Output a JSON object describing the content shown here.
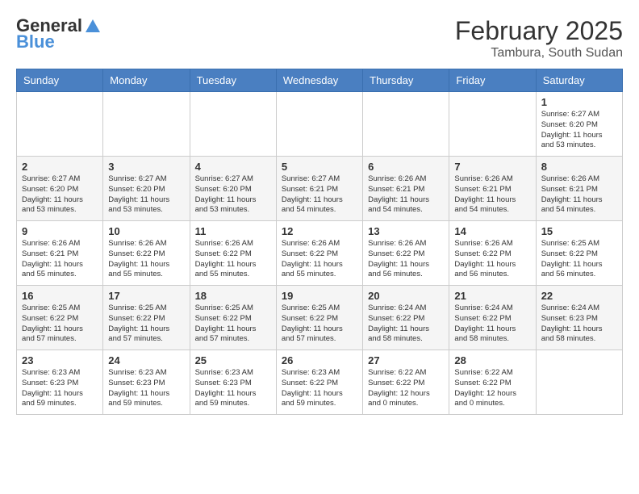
{
  "logo": {
    "line1": "General",
    "line2": "Blue"
  },
  "title": "February 2025",
  "subtitle": "Tambura, South Sudan",
  "weekdays": [
    "Sunday",
    "Monday",
    "Tuesday",
    "Wednesday",
    "Thursday",
    "Friday",
    "Saturday"
  ],
  "weeks": [
    [
      {
        "day": "",
        "info": ""
      },
      {
        "day": "",
        "info": ""
      },
      {
        "day": "",
        "info": ""
      },
      {
        "day": "",
        "info": ""
      },
      {
        "day": "",
        "info": ""
      },
      {
        "day": "",
        "info": ""
      },
      {
        "day": "1",
        "info": "Sunrise: 6:27 AM\nSunset: 6:20 PM\nDaylight: 11 hours\nand 53 minutes."
      }
    ],
    [
      {
        "day": "2",
        "info": "Sunrise: 6:27 AM\nSunset: 6:20 PM\nDaylight: 11 hours\nand 53 minutes."
      },
      {
        "day": "3",
        "info": "Sunrise: 6:27 AM\nSunset: 6:20 PM\nDaylight: 11 hours\nand 53 minutes."
      },
      {
        "day": "4",
        "info": "Sunrise: 6:27 AM\nSunset: 6:20 PM\nDaylight: 11 hours\nand 53 minutes."
      },
      {
        "day": "5",
        "info": "Sunrise: 6:27 AM\nSunset: 6:21 PM\nDaylight: 11 hours\nand 54 minutes."
      },
      {
        "day": "6",
        "info": "Sunrise: 6:26 AM\nSunset: 6:21 PM\nDaylight: 11 hours\nand 54 minutes."
      },
      {
        "day": "7",
        "info": "Sunrise: 6:26 AM\nSunset: 6:21 PM\nDaylight: 11 hours\nand 54 minutes."
      },
      {
        "day": "8",
        "info": "Sunrise: 6:26 AM\nSunset: 6:21 PM\nDaylight: 11 hours\nand 54 minutes."
      }
    ],
    [
      {
        "day": "9",
        "info": "Sunrise: 6:26 AM\nSunset: 6:21 PM\nDaylight: 11 hours\nand 55 minutes."
      },
      {
        "day": "10",
        "info": "Sunrise: 6:26 AM\nSunset: 6:22 PM\nDaylight: 11 hours\nand 55 minutes."
      },
      {
        "day": "11",
        "info": "Sunrise: 6:26 AM\nSunset: 6:22 PM\nDaylight: 11 hours\nand 55 minutes."
      },
      {
        "day": "12",
        "info": "Sunrise: 6:26 AM\nSunset: 6:22 PM\nDaylight: 11 hours\nand 55 minutes."
      },
      {
        "day": "13",
        "info": "Sunrise: 6:26 AM\nSunset: 6:22 PM\nDaylight: 11 hours\nand 56 minutes."
      },
      {
        "day": "14",
        "info": "Sunrise: 6:26 AM\nSunset: 6:22 PM\nDaylight: 11 hours\nand 56 minutes."
      },
      {
        "day": "15",
        "info": "Sunrise: 6:25 AM\nSunset: 6:22 PM\nDaylight: 11 hours\nand 56 minutes."
      }
    ],
    [
      {
        "day": "16",
        "info": "Sunrise: 6:25 AM\nSunset: 6:22 PM\nDaylight: 11 hours\nand 57 minutes."
      },
      {
        "day": "17",
        "info": "Sunrise: 6:25 AM\nSunset: 6:22 PM\nDaylight: 11 hours\nand 57 minutes."
      },
      {
        "day": "18",
        "info": "Sunrise: 6:25 AM\nSunset: 6:22 PM\nDaylight: 11 hours\nand 57 minutes."
      },
      {
        "day": "19",
        "info": "Sunrise: 6:25 AM\nSunset: 6:22 PM\nDaylight: 11 hours\nand 57 minutes."
      },
      {
        "day": "20",
        "info": "Sunrise: 6:24 AM\nSunset: 6:22 PM\nDaylight: 11 hours\nand 58 minutes."
      },
      {
        "day": "21",
        "info": "Sunrise: 6:24 AM\nSunset: 6:22 PM\nDaylight: 11 hours\nand 58 minutes."
      },
      {
        "day": "22",
        "info": "Sunrise: 6:24 AM\nSunset: 6:23 PM\nDaylight: 11 hours\nand 58 minutes."
      }
    ],
    [
      {
        "day": "23",
        "info": "Sunrise: 6:23 AM\nSunset: 6:23 PM\nDaylight: 11 hours\nand 59 minutes."
      },
      {
        "day": "24",
        "info": "Sunrise: 6:23 AM\nSunset: 6:23 PM\nDaylight: 11 hours\nand 59 minutes."
      },
      {
        "day": "25",
        "info": "Sunrise: 6:23 AM\nSunset: 6:23 PM\nDaylight: 11 hours\nand 59 minutes."
      },
      {
        "day": "26",
        "info": "Sunrise: 6:23 AM\nSunset: 6:22 PM\nDaylight: 11 hours\nand 59 minutes."
      },
      {
        "day": "27",
        "info": "Sunrise: 6:22 AM\nSunset: 6:22 PM\nDaylight: 12 hours\nand 0 minutes."
      },
      {
        "day": "28",
        "info": "Sunrise: 6:22 AM\nSunset: 6:22 PM\nDaylight: 12 hours\nand 0 minutes."
      },
      {
        "day": "",
        "info": ""
      }
    ]
  ]
}
